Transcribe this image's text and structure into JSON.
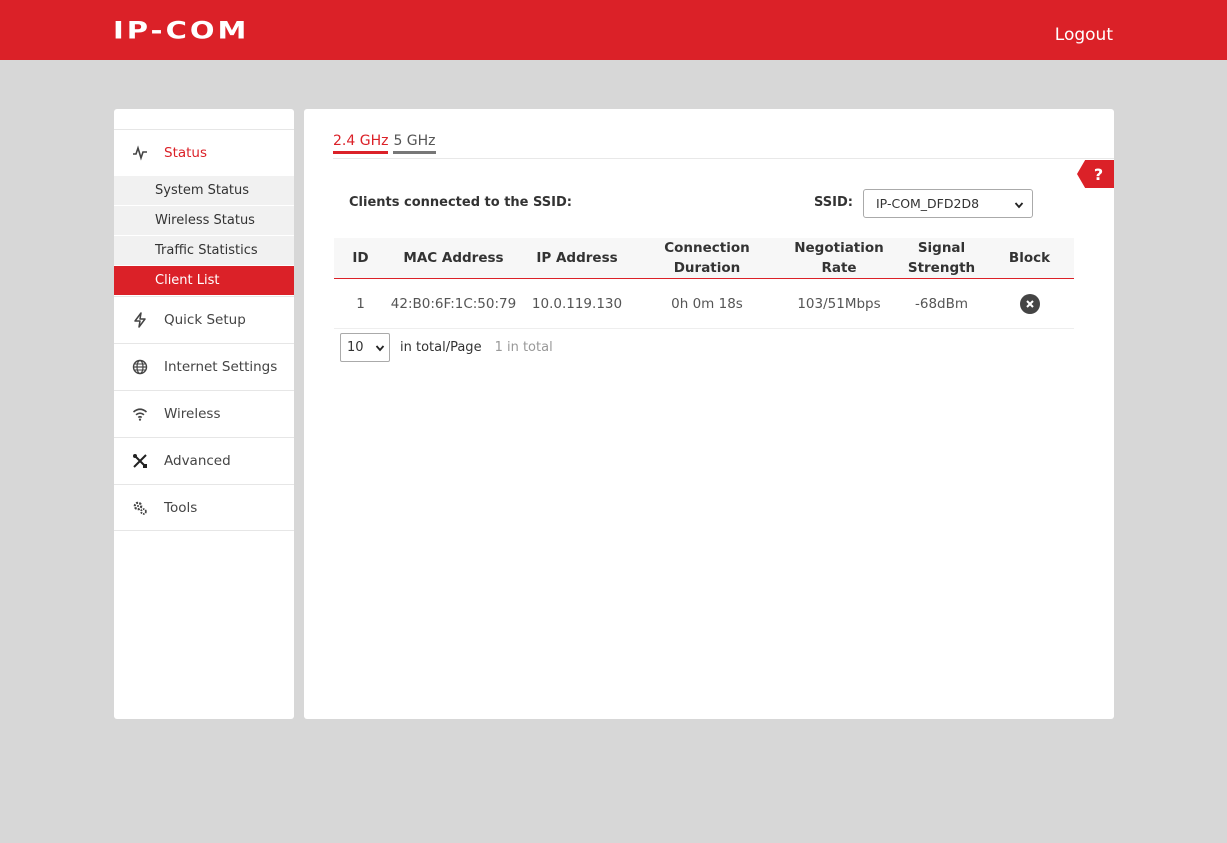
{
  "header": {
    "logo": "IP-COM",
    "logout": "Logout"
  },
  "sidebar": {
    "items": [
      {
        "label": "Status",
        "icon": "pulse-icon"
      },
      {
        "label": "Quick Setup",
        "icon": "bolt-icon"
      },
      {
        "label": "Internet Settings",
        "icon": "globe-icon"
      },
      {
        "label": "Wireless",
        "icon": "wifi-icon"
      },
      {
        "label": "Advanced",
        "icon": "tools-icon"
      },
      {
        "label": "Tools",
        "icon": "gears-icon"
      }
    ],
    "sub_items": [
      "System Status",
      "Wireless Status",
      "Traffic Statistics",
      "Client List"
    ]
  },
  "main": {
    "tabs": [
      "2.4 GHz",
      "5 GHz"
    ],
    "help": "?",
    "clients_label": "Clients connected to the SSID:",
    "ssid_label": "SSID:",
    "ssid_value": "IP-COM_DFD2D8",
    "table": {
      "headers": [
        "ID",
        "MAC Address",
        "IP Address",
        "Connection Duration",
        "Negotiation Rate",
        "Signal Strength",
        "Block"
      ],
      "rows": [
        [
          "1",
          "42:B0:6F:1C:50:79",
          "10.0.119.130",
          "0h 0m 18s",
          "103/51Mbps",
          "-68dBm"
        ]
      ]
    },
    "pager": {
      "page_size": "10",
      "per_page_label": "in total/Page",
      "total_label": "1 in total"
    }
  },
  "colors": {
    "accent": "#db2128",
    "background": "#d7d7d7"
  }
}
